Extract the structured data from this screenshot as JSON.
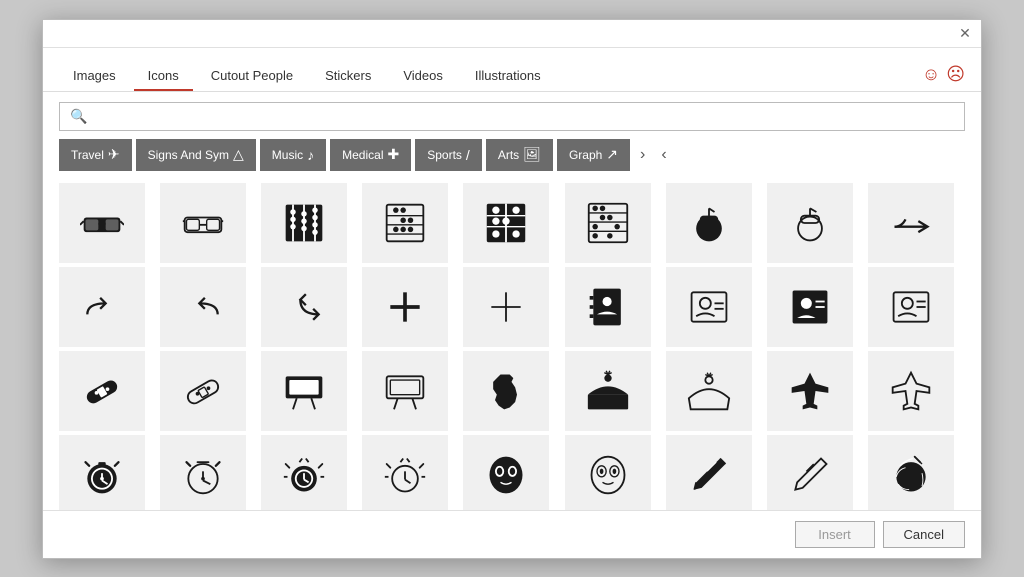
{
  "dialog": {
    "title": "Icons"
  },
  "tabs": [
    {
      "id": "images",
      "label": "Images",
      "active": false
    },
    {
      "id": "icons",
      "label": "Icons",
      "active": true
    },
    {
      "id": "cutout",
      "label": "Cutout People",
      "active": false
    },
    {
      "id": "stickers",
      "label": "Stickers",
      "active": false
    },
    {
      "id": "videos",
      "label": "Videos",
      "active": false
    },
    {
      "id": "illustrations",
      "label": "Illustrations",
      "active": false
    }
  ],
  "search": {
    "placeholder": ""
  },
  "categories": [
    {
      "id": "travel",
      "label": "Travel"
    },
    {
      "id": "signs",
      "label": "Signs And Sym"
    },
    {
      "id": "music",
      "label": "Music"
    },
    {
      "id": "medical",
      "label": "Medical"
    },
    {
      "id": "sports",
      "label": "Sports"
    },
    {
      "id": "arts",
      "label": "Arts"
    },
    {
      "id": "graph",
      "label": "Graph"
    }
  ],
  "footer": {
    "insert_label": "Insert",
    "cancel_label": "Cancel"
  }
}
